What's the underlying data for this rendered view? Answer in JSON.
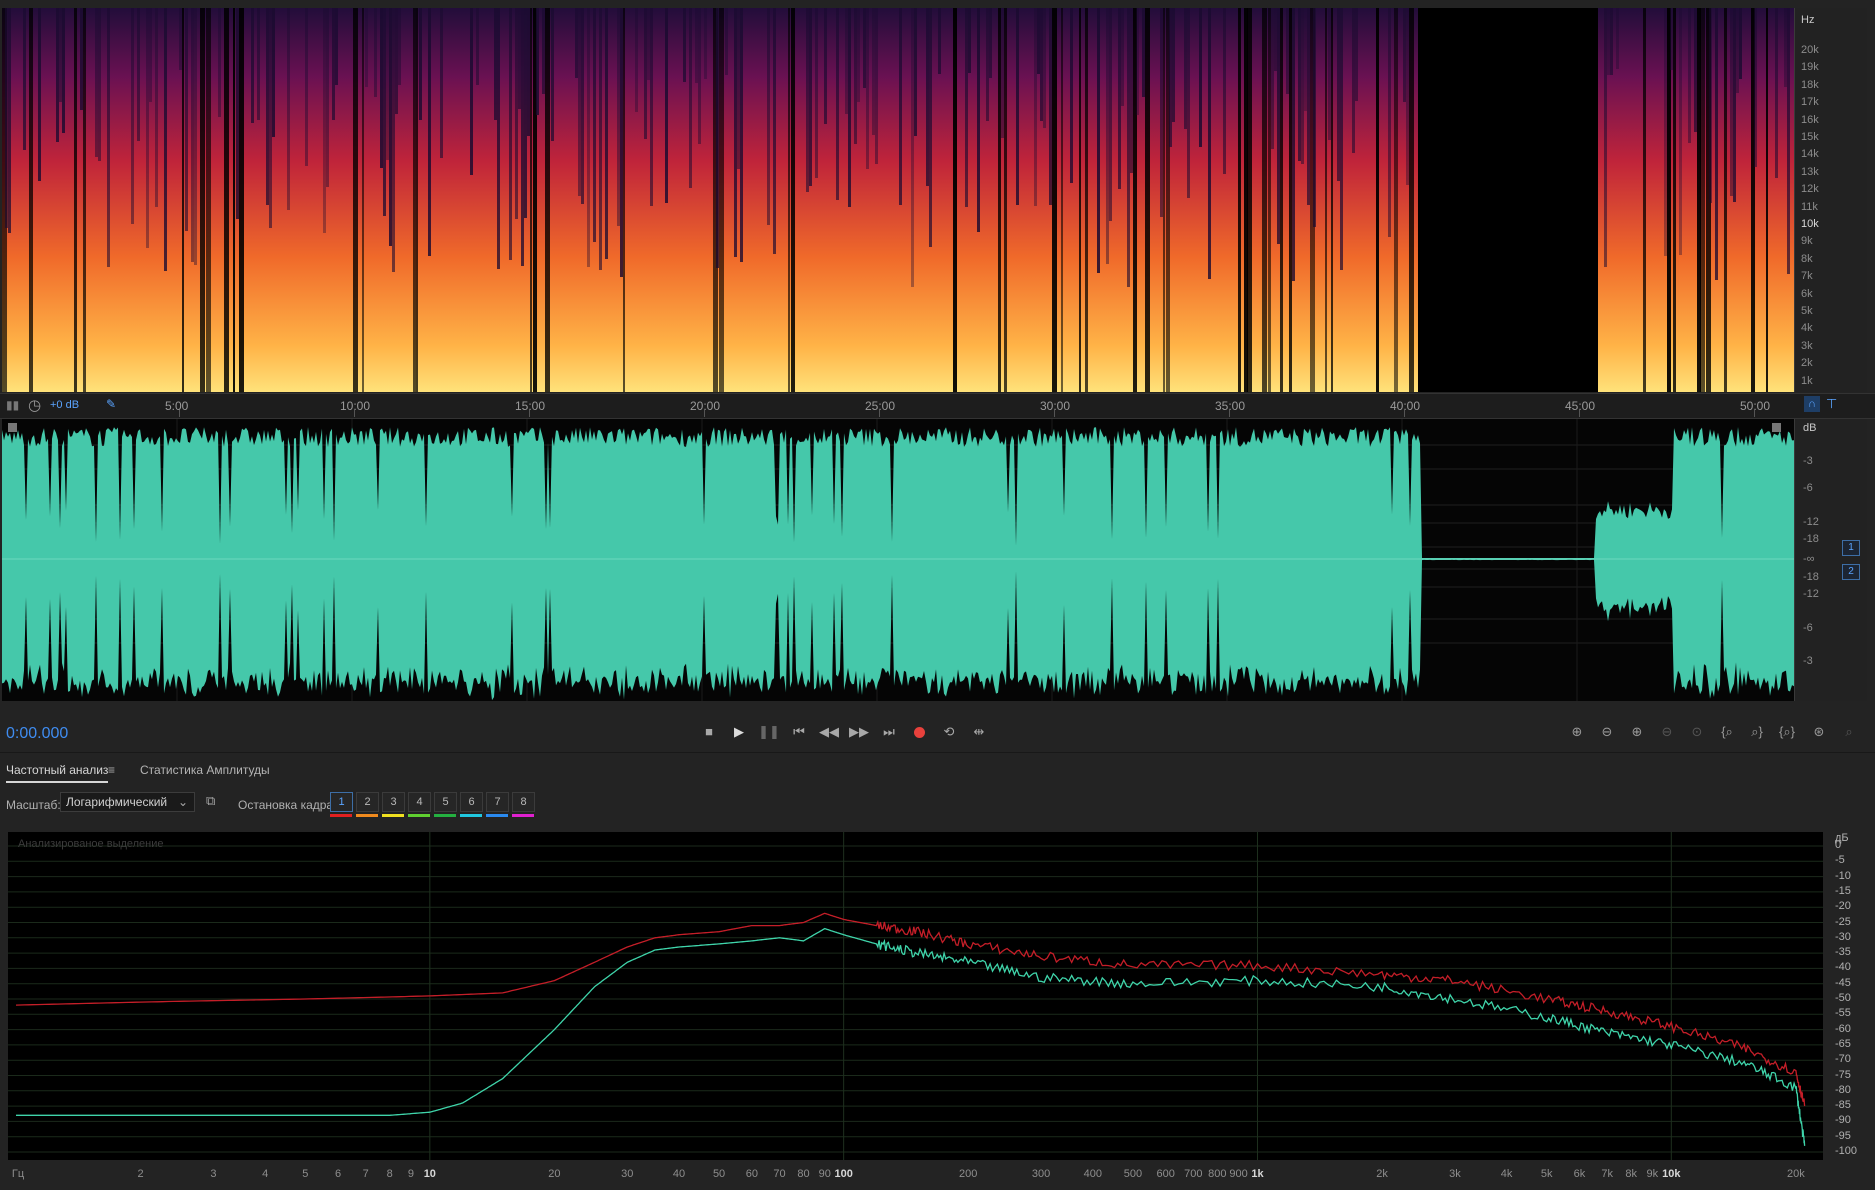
{
  "spectrogram": {
    "unit": "Hz",
    "freq_labels": [
      "20k",
      "19k",
      "18k",
      "17k",
      "16k",
      "15k",
      "14k",
      "13k",
      "12k",
      "11k",
      "10k",
      "9k",
      "8k",
      "7k",
      "6k",
      "5k",
      "4k",
      "3k",
      "2k",
      "1k"
    ],
    "bold_label": "10k"
  },
  "ruler": {
    "gain": "+0 dB",
    "time_labels": [
      "5:00",
      "10:00",
      "15:00",
      "20:00",
      "25:00",
      "30:00",
      "35:00",
      "40:00",
      "45:00",
      "50:00"
    ]
  },
  "waveform": {
    "unit": "dB",
    "db_labels_top": [
      "-3",
      "-6",
      "-12",
      "-18"
    ],
    "center": "-∞",
    "db_labels_bottom": [
      "-18",
      "-12",
      "-6",
      "-3"
    ],
    "channels": [
      "1",
      "2"
    ],
    "color": "#45c8aa"
  },
  "transport": {
    "timecode": "0:00.000",
    "record_color": "#e8413c",
    "buttons": [
      "stop-icon",
      "play-icon",
      "pause-icon",
      "go-to-start-icon",
      "rewind-icon",
      "fast-forward-icon",
      "go-to-end-icon",
      "record-icon",
      "loop-icon",
      "skip-selection-icon"
    ]
  },
  "panel": {
    "tabs": [
      "Частотный анализ",
      "Статистика Амплитуды"
    ],
    "scale_label": "Масштаб:",
    "scale_value": "Логарифмический",
    "freeze_label": "Остановка кадра:",
    "frames": [
      "1",
      "2",
      "3",
      "4",
      "5",
      "6",
      "7",
      "8"
    ],
    "frame_colors": [
      "#e02020",
      "#f08a1e",
      "#f0e020",
      "#60d030",
      "#24b040",
      "#20c8e0",
      "#2a8af0",
      "#e020d0"
    ],
    "analyzed_label": "Анализированое выделение"
  },
  "chart_data": {
    "type": "line",
    "xlabel": "Гц",
    "ylabel": "дБ",
    "x_scale": "log",
    "x_ticks": [
      "Гц",
      "2",
      "3",
      "4",
      "5",
      "6",
      "7",
      "8",
      "9",
      "10",
      "20",
      "30",
      "40",
      "50",
      "60",
      "70",
      "80",
      "90",
      "100",
      "200",
      "300",
      "400",
      "500",
      "600",
      "700",
      "800",
      "900",
      "1k",
      "2k",
      "3k",
      "4k",
      "5k",
      "6k",
      "7k",
      "8k",
      "9k",
      "10k",
      "20k"
    ],
    "y_ticks": [
      "дБ",
      "0",
      "-5",
      "-10",
      "-15",
      "-20",
      "-25",
      "-30",
      "-35",
      "-40",
      "-45",
      "-50",
      "-55",
      "-60",
      "-65",
      "-70",
      "-75",
      "-80",
      "-85",
      "-90",
      "-95",
      "-100"
    ],
    "ylim": [
      -100,
      0
    ],
    "xlim": [
      1,
      22000
    ],
    "grid": true,
    "series": [
      {
        "color": "#c41e28",
        "x": [
          1,
          2,
          5,
          10,
          15,
          20,
          25,
          30,
          35,
          40,
          50,
          60,
          70,
          80,
          90,
          100,
          120,
          150,
          200,
          300,
          500,
          1000,
          2000,
          3000,
          5000,
          7000,
          10000,
          15000,
          20000,
          21000
        ],
        "y": [
          -52,
          -51,
          -50,
          -49,
          -48,
          -44,
          -38,
          -33,
          -30,
          -29,
          -28,
          -26,
          -26,
          -25,
          -22,
          -24,
          -26,
          -28,
          -32,
          -36,
          -39,
          -39,
          -42,
          -44,
          -50,
          -54,
          -59,
          -66,
          -74,
          -85
        ]
      },
      {
        "color": "#3fd4aa",
        "x": [
          1,
          3,
          5,
          8,
          10,
          12,
          15,
          20,
          25,
          30,
          35,
          40,
          50,
          60,
          70,
          80,
          90,
          100,
          120,
          150,
          200,
          300,
          500,
          1000,
          2000,
          3000,
          5000,
          7000,
          10000,
          15000,
          20000,
          21000
        ],
        "y": [
          -88,
          -88,
          -88,
          -88,
          -87,
          -84,
          -76,
          -60,
          -46,
          -38,
          -34,
          -33,
          -32,
          -31,
          -30,
          -31,
          -27,
          -29,
          -32,
          -35,
          -38,
          -43,
          -45,
          -44,
          -46,
          -50,
          -56,
          -61,
          -65,
          -71,
          -79,
          -98
        ]
      }
    ]
  }
}
